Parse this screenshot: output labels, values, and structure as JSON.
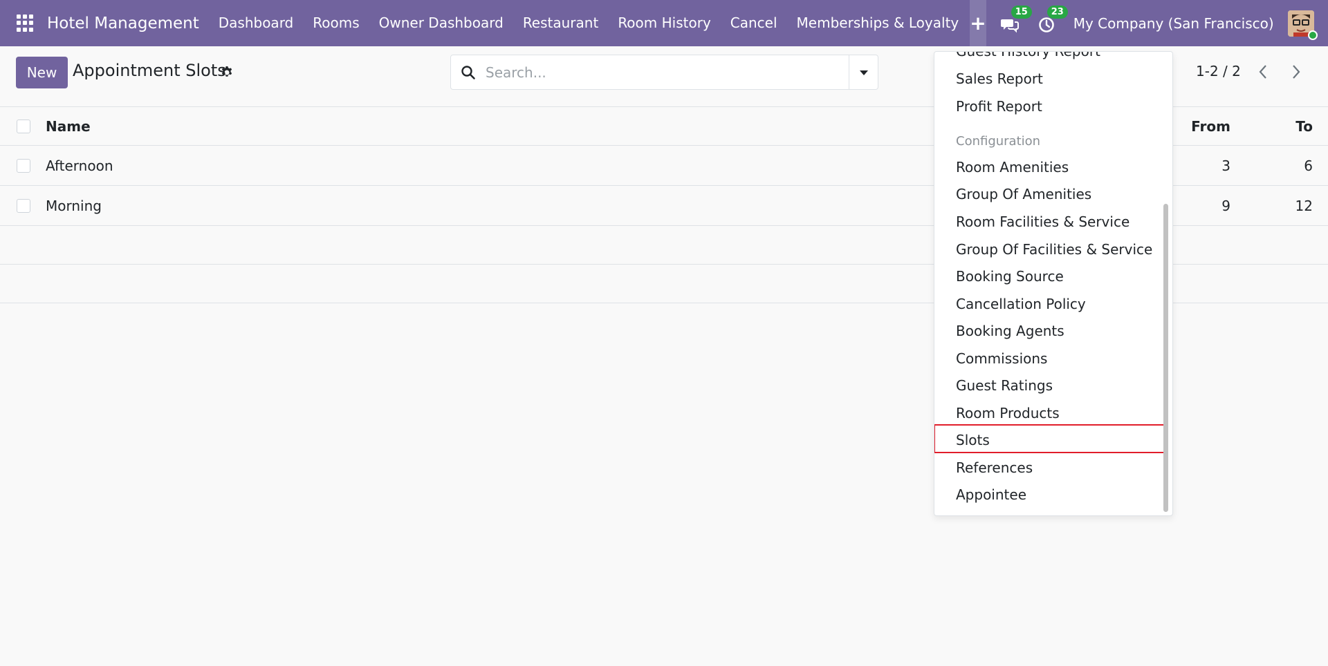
{
  "navbar": {
    "app_title": "Hotel Management",
    "menu": [
      "Dashboard",
      "Rooms",
      "Owner Dashboard",
      "Restaurant",
      "Room History",
      "Cancel",
      "Memberships & Loyalty"
    ],
    "plus_label": "+",
    "messages_count": "15",
    "activities_count": "23",
    "company": "My Company (San Francisco)",
    "color": "#71639e"
  },
  "control": {
    "new_label": "New",
    "title": "Appointment Slots",
    "search_placeholder": "Search...",
    "pager": "1-2 / 2"
  },
  "table": {
    "columns": {
      "name": "Name",
      "from": "From",
      "to": "To"
    },
    "rows": [
      {
        "name": "Afternoon",
        "from": "3",
        "to": "6"
      },
      {
        "name": "Morning",
        "from": "9",
        "to": "12"
      }
    ]
  },
  "dropdown": {
    "top_partial": "Guest History Report",
    "reports": [
      "Sales Report",
      "Profit Report"
    ],
    "section_header": "Configuration",
    "config_items": [
      "Room Amenities",
      "Group Of Amenities",
      "Room Facilities & Service",
      "Group Of Facilities & Service",
      "Booking Source",
      "Cancellation Policy",
      "Booking Agents",
      "Commissions",
      "Guest Ratings",
      "Room Products",
      "Slots",
      "References",
      "Appointee"
    ],
    "highlighted_item": "Slots",
    "highlight_color": "#e11d2a"
  }
}
